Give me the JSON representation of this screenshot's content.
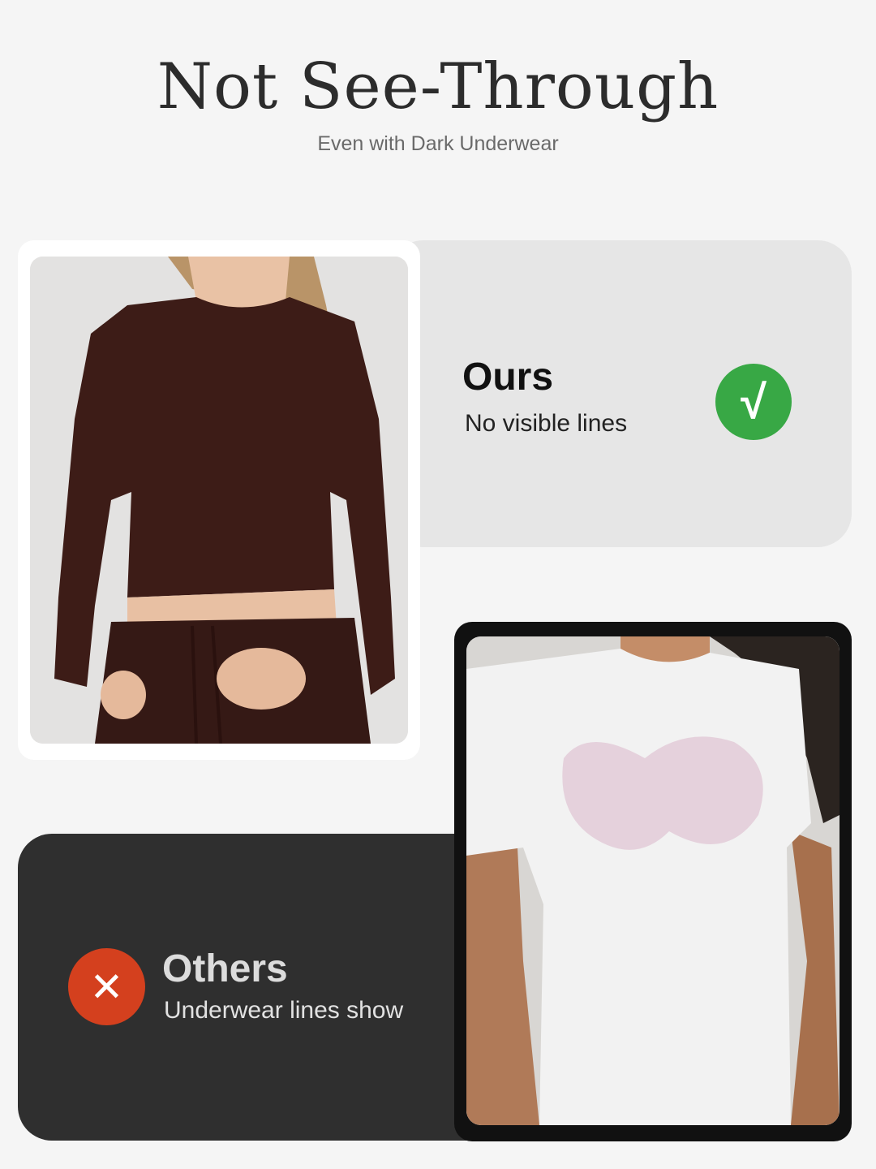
{
  "header": {
    "title": "Not See-Through",
    "subtitle": "Even with Dark Underwear"
  },
  "ours": {
    "label": "Ours",
    "description": "No visible lines",
    "badge_icon": "check-icon",
    "badge_glyph": "√",
    "badge_color": "#38a845",
    "shirt_color": "#3d1c17"
  },
  "others": {
    "label": "Others",
    "description": "Underwear lines show",
    "badge_icon": "close-icon",
    "badge_glyph": "✕",
    "badge_color": "#d4401e",
    "shirt_color": "#f2f2f2"
  }
}
